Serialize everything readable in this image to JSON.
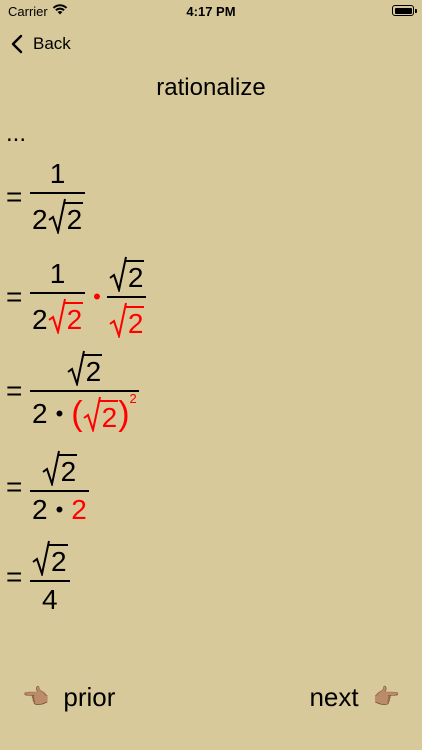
{
  "status_bar": {
    "carrier": "Carrier",
    "time": "4:17 PM"
  },
  "nav_bar": {
    "back_label": "Back",
    "title": "rationalize"
  },
  "math": {
    "ellipsis": "...",
    "eq": "=",
    "one": "1",
    "two": "2",
    "four": "4",
    "dot": "•",
    "sq_exp": "2",
    "lparen": "(",
    "rparen": ")"
  },
  "footer": {
    "prior_label": "prior",
    "next_label": "next",
    "prior_hand": "👈🏽",
    "next_hand": "👉🏽"
  },
  "colors": {
    "background": "#d8c99a",
    "highlight": "#ff0000",
    "text": "#000000"
  }
}
